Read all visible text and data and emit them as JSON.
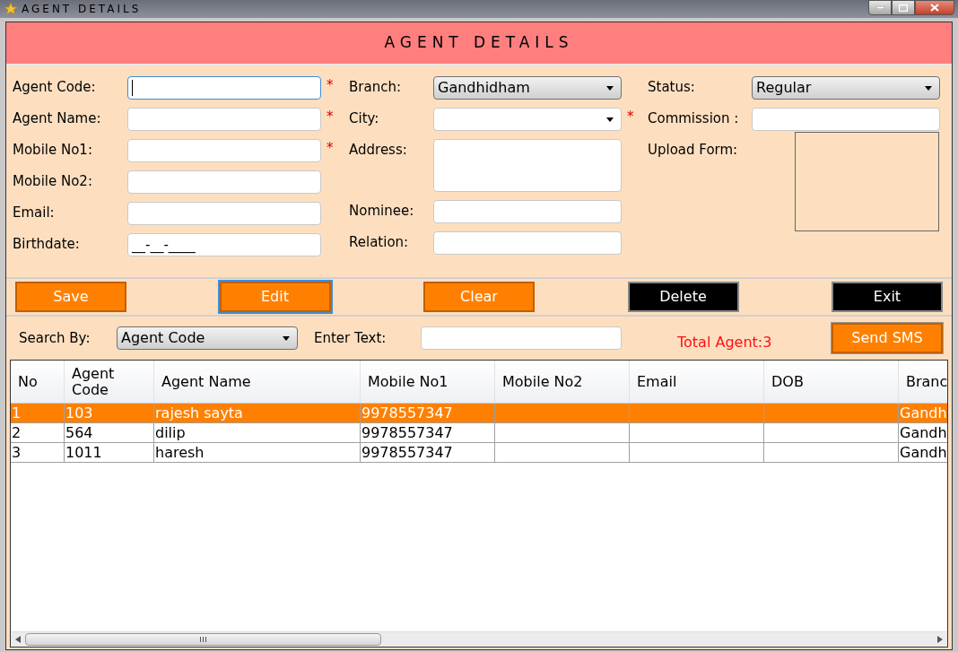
{
  "window": {
    "title": "AGENT DETAILS"
  },
  "header": {
    "title": "AGENT DETAILS"
  },
  "form_columns": [
    [
      {
        "label": "Agent Code:",
        "kind": "text",
        "required": true,
        "focused": true
      },
      {
        "label": "Agent Name:",
        "kind": "text",
        "required": true,
        "focused": false
      },
      {
        "label": "Mobile No1:",
        "kind": "text",
        "required": true,
        "focused": false
      },
      {
        "label": "Mobile No2:",
        "kind": "text",
        "required": false,
        "focused": false
      },
      {
        "label": "Email:",
        "kind": "text",
        "required": false,
        "focused": false
      },
      {
        "label": "Birthdate:",
        "kind": "text",
        "value": "__-__-____",
        "required": false,
        "focused": false
      }
    ],
    [
      {
        "label": "Branch:",
        "kind": "dropdown",
        "value": "Gandhidham",
        "required": false,
        "focused": false
      },
      {
        "label": "City:",
        "kind": "combo",
        "required": true,
        "focused": false
      },
      {
        "label": "Address:",
        "kind": "textarea",
        "required": false,
        "focused": false
      },
      {
        "label": "Nominee:",
        "kind": "text",
        "required": false,
        "focused": false
      },
      {
        "label": "Relation:",
        "kind": "text",
        "required": false,
        "focused": false
      }
    ],
    [
      {
        "label": "Status:",
        "kind": "dropdown",
        "value": "Regular",
        "required": false,
        "focused": false
      },
      {
        "label": "Commission :",
        "kind": "text",
        "required": false,
        "focused": false
      },
      {
        "label": "Upload Form:",
        "kind": "upload",
        "required": false,
        "focused": false
      }
    ]
  ],
  "required_mark": "*",
  "actions": [
    {
      "label": "Save",
      "kind": "orange",
      "focused": false
    },
    {
      "label": "Edit",
      "kind": "orange",
      "focused": true
    },
    {
      "label": "Clear",
      "kind": "orange",
      "focused": false
    },
    {
      "label": "Delete",
      "kind": "black",
      "focused": false
    },
    {
      "label": "Exit",
      "kind": "black",
      "focused": false
    }
  ],
  "search": {
    "label": "Search By:",
    "by": "Agent Code",
    "text_label": "Enter Text:",
    "total": "Total Agent:3",
    "sms_button": "Send SMS"
  },
  "table": {
    "columns": [
      "No",
      "Agent Code",
      "Agent Name",
      "Mobile No1",
      "Mobile No2",
      "Email",
      "DOB",
      "Branc"
    ],
    "rows": [
      {
        "selected": true,
        "cells": [
          "1",
          "103",
          "rajesh sayta",
          "9978557347",
          null,
          null,
          null,
          "Gandh"
        ]
      },
      {
        "selected": false,
        "cells": [
          "2",
          "564",
          "dilip",
          "9978557347",
          null,
          null,
          null,
          "Gandh"
        ]
      },
      {
        "selected": false,
        "cells": [
          "3",
          "1011",
          "haresh",
          "9978557347",
          null,
          null,
          null,
          "Gandh"
        ]
      }
    ]
  }
}
